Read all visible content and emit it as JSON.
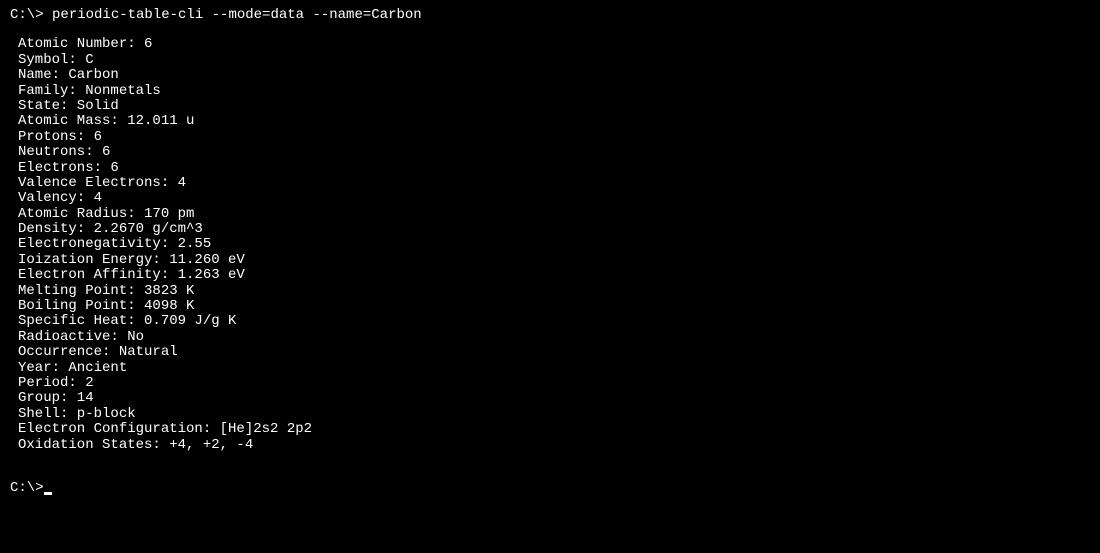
{
  "prompt1": {
    "prefix": "C:\\>",
    "command": " periodic-table-cli --mode=data --name=Carbon"
  },
  "output": {
    "lines": [
      "Atomic Number: 6",
      "Symbol: C",
      "Name: Carbon",
      "Family: Nonmetals",
      "State: Solid",
      "Atomic Mass: 12.011 u",
      "Protons: 6",
      "Neutrons: 6",
      "Electrons: 6",
      "Valence Electrons: 4",
      "Valency: 4",
      "Atomic Radius: 170 pm",
      "Density: 2.2670 g/cm^3",
      "Electronegativity: 2.55",
      "Ioization Energy: 11.260 eV",
      "Electron Affinity: 1.263 eV",
      "Melting Point: 3823 K",
      "Boiling Point: 4098 K",
      "Specific Heat: 0.709 J/g K",
      "Radioactive: No",
      "Occurrence: Natural",
      "Year: Ancient",
      "Period: 2",
      "Group: 14",
      "Shell: p-block",
      "Electron Configuration: [He]2s2 2p2",
      "Oxidation States: +4, +2, -4"
    ]
  },
  "prompt2": {
    "prefix": "C:\\>"
  }
}
